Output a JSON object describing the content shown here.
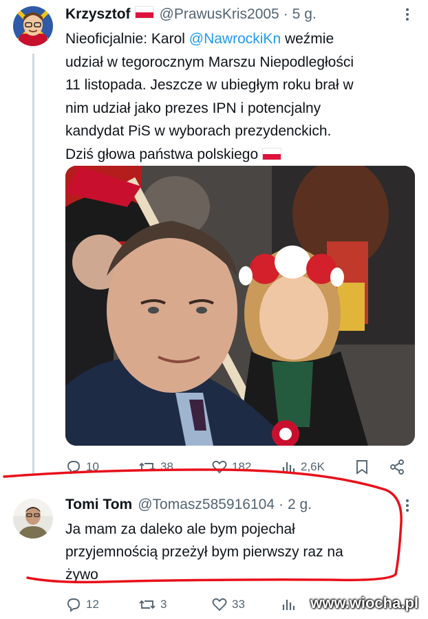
{
  "tweet1": {
    "author_name": "Krzysztof",
    "handle": "@PrawusKris2005",
    "separator": "·",
    "time": "5 g.",
    "text_before_mention": "Nieoficjalnie: Karol ",
    "mention": "@NawrockiKn",
    "text_after_mention": " weźmie",
    "lines": [
      "udział w tegorocznym Marszu Niepodległości",
      "11 listopada. Jeszcze w ubiegłym roku brał w",
      "nim udział jako prezes IPN i potencjalny",
      "kandydat PiS w wyborach prezydenckich."
    ],
    "last_line": "Dziś głowa państwa polskiego",
    "stats": {
      "replies": "10",
      "retweets": "38",
      "likes": "182",
      "views": "2,6K"
    }
  },
  "tweet2": {
    "author_name": "Tomi Tom",
    "handle": "@Tomasz585916104",
    "separator": "·",
    "time": "2 g.",
    "lines": [
      "Ja mam za daleko ale bym pojechał",
      "przyjemnością przeżył bym pierwszy raz na",
      "żywo"
    ],
    "stats": {
      "replies": "12",
      "retweets": "3",
      "likes": "33"
    }
  },
  "watermark": "www.wiocha.pl",
  "colors": {
    "text": "#0f1419",
    "secondary": "#536471",
    "link": "#1d9bf0",
    "annotation": "#e8101a"
  }
}
